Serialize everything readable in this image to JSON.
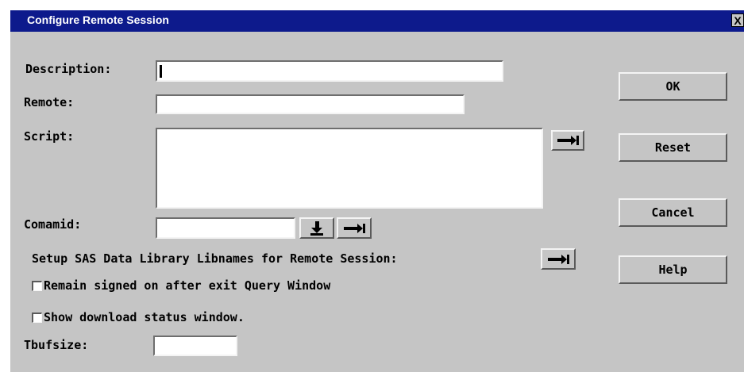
{
  "window": {
    "title": "Configure Remote Session",
    "close_label": "X"
  },
  "form": {
    "description": {
      "label": "Description:",
      "value": ""
    },
    "remote": {
      "label": "Remote:",
      "value": ""
    },
    "script": {
      "label": "Script:",
      "value": ""
    },
    "comamid": {
      "label": "Comamid:",
      "value": ""
    },
    "setup_libnames": {
      "label": "Setup SAS Data Library Libnames for Remote Session:"
    },
    "remain_signed_on": {
      "label": "Remain signed on after exit Query Window",
      "checked": false
    },
    "show_download_status": {
      "label": "Show download status window.",
      "checked": false
    },
    "tbufsize": {
      "label": "Tbufsize:",
      "value": ""
    }
  },
  "buttons": {
    "ok": "OK",
    "reset": "Reset",
    "cancel": "Cancel",
    "help": "Help"
  },
  "icons": {
    "browse": "arrow-to-bar-right-icon",
    "dropdown": "arrow-to-bar-down-icon"
  }
}
